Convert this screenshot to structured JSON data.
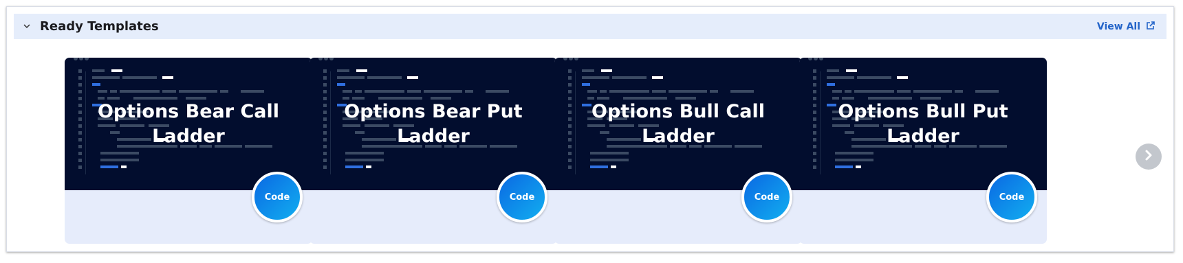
{
  "section": {
    "title": "Ready Templates",
    "view_all_label": "View All",
    "toggle_icon": "chevron-down-icon",
    "view_all_icon": "external-link-icon"
  },
  "cards": [
    {
      "title": "Options Bear Call Ladder",
      "badge": "Code"
    },
    {
      "title": "Options Bear Put Ladder",
      "badge": "Code"
    },
    {
      "title": "Options Bull Call Ladder",
      "badge": "Code"
    },
    {
      "title": "Options Bull Put Ladder",
      "badge": "Code"
    }
  ],
  "carousel": {
    "next_icon": "chevron-right-icon"
  },
  "colors": {
    "header_bg": "#e5edfb",
    "card_bg": "#e6ecfb",
    "code_preview_bg": "#020d2e",
    "link": "#2364c9",
    "badge_gradient_start": "#0a69e3",
    "badge_gradient_end": "#12aef0"
  }
}
